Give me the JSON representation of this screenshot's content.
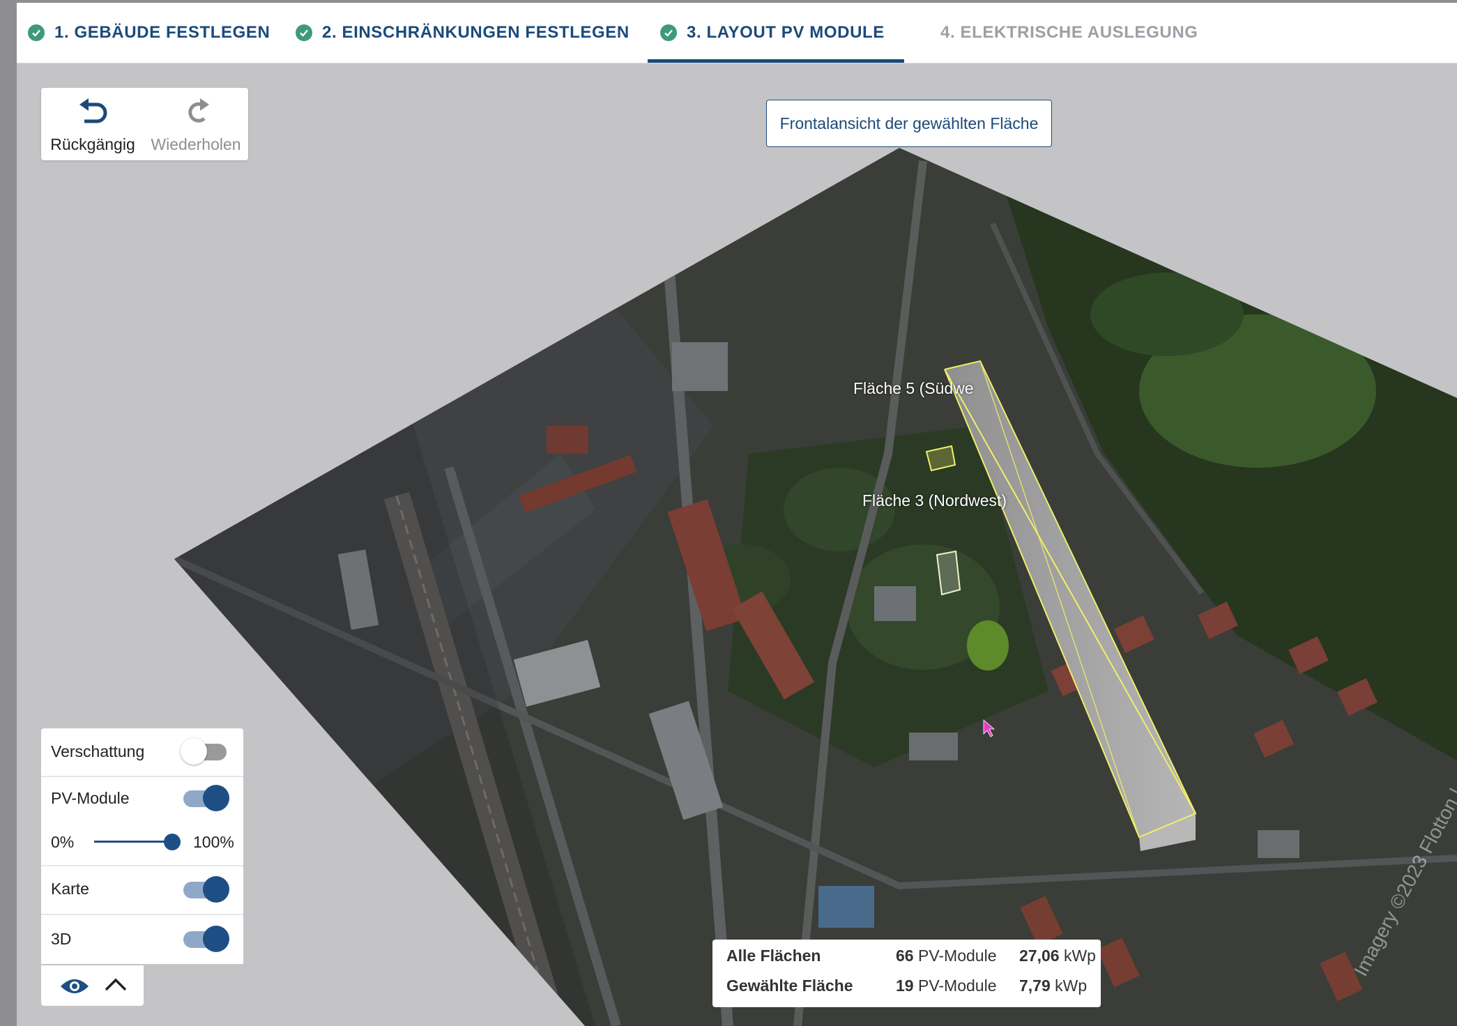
{
  "tabs": [
    {
      "label": "1. GEBÄUDE FESTLEGEN",
      "done": true
    },
    {
      "label": "2. EINSCHRÄNKUNGEN FESTLEGEN",
      "done": true
    },
    {
      "label": "3. LAYOUT PV MODULE",
      "done": true,
      "active": true
    },
    {
      "label": "4. ELEKTRISCHE AUSLEGUNG",
      "done": false
    }
  ],
  "toolbar": {
    "undo_label": "Rückgängig",
    "redo_label": "Wiederholen"
  },
  "frontal_button": "Frontalansicht der gewählten Fläche",
  "map": {
    "labels": [
      "Fläche 5 (Südwe",
      "Fläche 3 (Nordwest)"
    ],
    "attribution": "Imagery ©2023 Flotton | ..."
  },
  "panel": {
    "shading_label": "Verschattung",
    "shading_on": false,
    "pv_modules_label": "PV-Module",
    "pv_modules_on": true,
    "opacity_min": "0%",
    "opacity_max": "100%",
    "opacity_value": 1.0,
    "map_label": "Karte",
    "map_on": true,
    "threed_label": "3D",
    "threed_on": true
  },
  "stats": {
    "all": {
      "label": "Alle Flächen",
      "modules": "66",
      "modules_unit": "PV-Module",
      "power": "27,06",
      "power_unit": "kWp"
    },
    "selected": {
      "label": "Gewählte Fläche",
      "modules": "19",
      "modules_unit": "PV-Module",
      "power": "7,79",
      "power_unit": "kWp"
    }
  },
  "colors": {
    "accent": "#1b4a7a",
    "check": "#3e9a7a",
    "toggle_on": "#1d4f85",
    "building_outline": "#f0ee6a"
  }
}
